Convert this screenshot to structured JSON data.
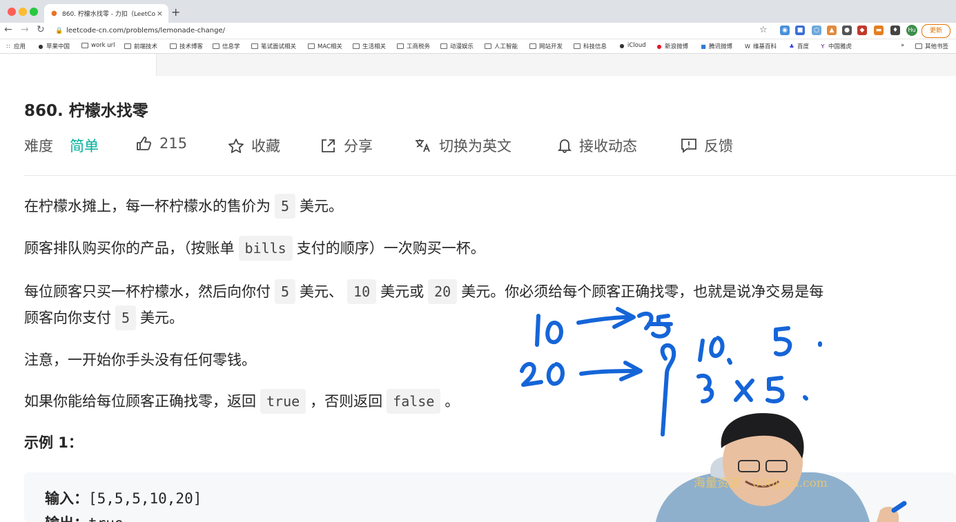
{
  "browser": {
    "tab_title": "860. 柠檬水找零 - 力扣（LeetCo",
    "tab_close": "×",
    "new_tab": "+",
    "url": "leetcode-cn.com/problems/lemonade-change/",
    "profile_initials": "Hu",
    "update_label": "更新",
    "bookmarks": [
      {
        "label": "应用",
        "icon": "apps-grid-icon"
      },
      {
        "label": "苹果中国",
        "icon": "apple-icon"
      },
      {
        "label": "work url",
        "icon": "folder-icon"
      },
      {
        "label": "前端技术",
        "icon": "folder-icon"
      },
      {
        "label": "技术博客",
        "icon": "folder-icon"
      },
      {
        "label": "信息学",
        "icon": "folder-icon"
      },
      {
        "label": "笔试面试相关",
        "icon": "folder-icon"
      },
      {
        "label": "MAC相关",
        "icon": "folder-icon"
      },
      {
        "label": "生活相关",
        "icon": "folder-icon"
      },
      {
        "label": "工商税务",
        "icon": "folder-icon"
      },
      {
        "label": "动漫娱乐",
        "icon": "folder-icon"
      },
      {
        "label": "人工智能",
        "icon": "folder-icon"
      },
      {
        "label": "网站开发",
        "icon": "folder-icon"
      },
      {
        "label": "科技信息",
        "icon": "folder-icon"
      },
      {
        "label": "iCloud",
        "icon": "apple-icon"
      },
      {
        "label": "新浪微博",
        "icon": "weibo-icon"
      },
      {
        "label": "腾讯微博",
        "icon": "tencent-icon"
      },
      {
        "label": "维基百科",
        "icon": "wikipedia-icon"
      },
      {
        "label": "百度",
        "icon": "baidu-icon"
      },
      {
        "label": "中国雅虎",
        "icon": "yahoo-icon"
      }
    ],
    "bookmarks_overflow": "»",
    "other_bookmarks": "其他书签"
  },
  "problem": {
    "title": "860. 柠檬水找零",
    "difficulty_label": "难度",
    "difficulty_value": "简单",
    "likes": "215",
    "favorite": "收藏",
    "share": "分享",
    "switch_lang": "切换为英文",
    "notify": "接收动态",
    "feedback": "反馈",
    "difficulty_color": "#00af9b"
  },
  "description": {
    "p1_a": "在柠檬水摊上，每一杯柠檬水的售价为",
    "p1_code": "5",
    "p1_b": "美元。",
    "p2_a": "顾客排队购买你的产品，（按账单",
    "p2_code": "bills",
    "p2_b": "支付的顺序）一次购买一杯。",
    "p3_a": "每位顾客只买一杯柠檬水，然后向你付",
    "p3_code1": "5",
    "p3_b": "美元、",
    "p3_code2": "10",
    "p3_c": "美元或",
    "p3_code3": "20",
    "p3_d": "美元。你必须给每个顾客正确找零，也就是说净交易是每",
    "p3_line2_a": "顾客向你支付",
    "p3_line2_code": "5",
    "p3_line2_b": "美元。",
    "p4": "注意，一开始你手头没有任何零钱。",
    "p5_a": "如果你能给每位顾客正确找零，返回",
    "p5_code1": "true",
    "p5_b": "，否则返回",
    "p5_code2": "false",
    "p5_c": "。"
  },
  "example": {
    "title": "示例 1：",
    "input_label": "输入：",
    "input_value": "[5,5,5,10,20]",
    "output_label": "输出：",
    "output_value": "true"
  },
  "overlay": {
    "watermark": "海量资源：666java.com",
    "ink_color": "#1565d8"
  }
}
